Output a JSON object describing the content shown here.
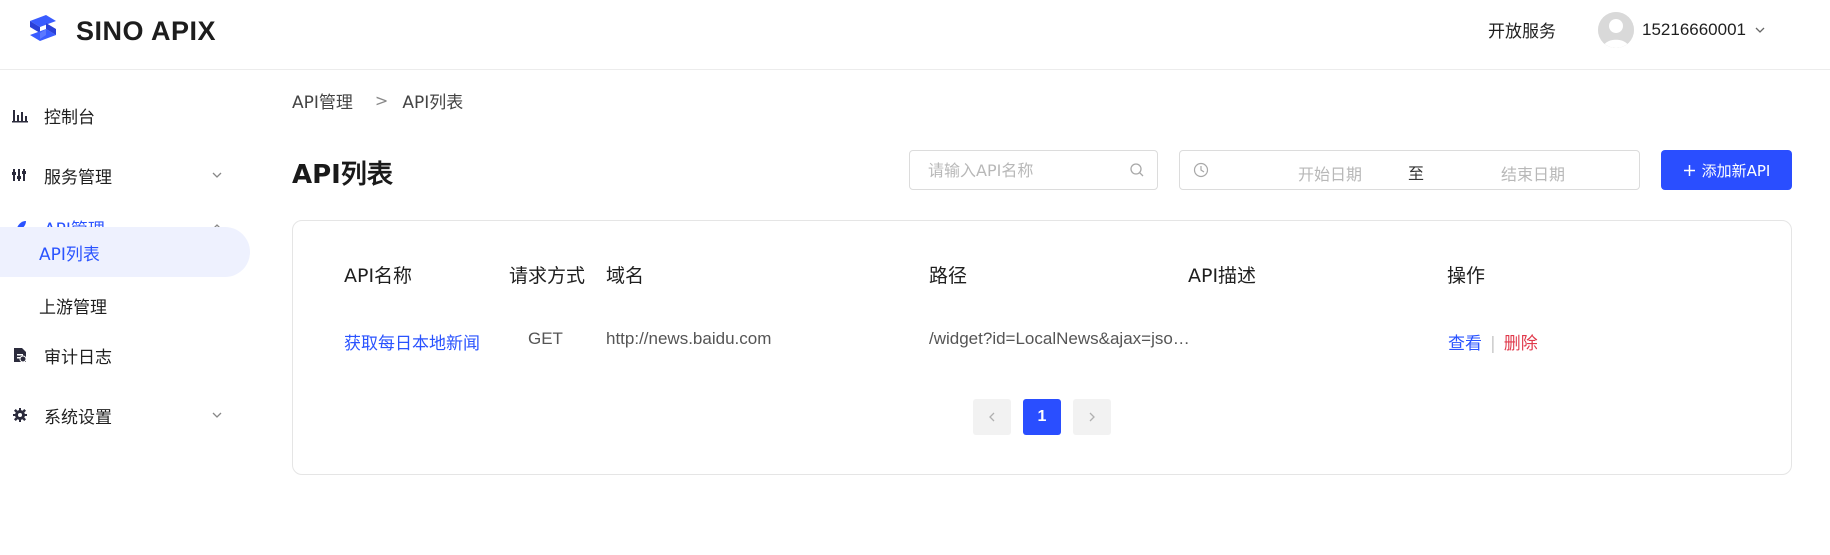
{
  "header": {
    "brand": "SINO APIX",
    "open_service": "开放服务",
    "user_phone": "15216660001"
  },
  "colors": {
    "accent": "#2a4eff",
    "link": "#2a53ff",
    "danger": "#e0394b",
    "sidebar_selected_bg": "#eef1fe"
  },
  "sidebar": {
    "items": [
      {
        "label": "控制台",
        "icon": "bar-chart-icon"
      },
      {
        "label": "服务管理",
        "icon": "sliders-icon",
        "expandable": true,
        "expanded": false
      },
      {
        "label": "API管理",
        "icon": "rocket-icon",
        "expandable": true,
        "expanded": true
      },
      {
        "label": "API列表",
        "sub": true,
        "selected": true
      },
      {
        "label": "上游管理",
        "sub": true
      },
      {
        "label": "审计日志",
        "icon": "log-file-icon"
      },
      {
        "label": "系统设置",
        "icon": "gear-icon",
        "expandable": true,
        "expanded": false
      }
    ]
  },
  "breadcrumb": {
    "parent": "API管理",
    "separator": ">",
    "current": "API列表"
  },
  "page": {
    "title": "API列表"
  },
  "search": {
    "placeholder": "请输入API名称",
    "value": ""
  },
  "date_range": {
    "start_placeholder": "开始日期",
    "separator": "至",
    "end_placeholder": "结束日期"
  },
  "toolbar": {
    "add_label": "添加新API"
  },
  "table": {
    "columns": [
      "API名称",
      "请求方式",
      "域名",
      "路径",
      "API描述",
      "操作"
    ],
    "rows": [
      {
        "name": "获取每日本地新闻",
        "method": "GET",
        "domain": "http://news.baidu.com",
        "path": "/widget?id=LocalNews&ajax=jso…",
        "description": "",
        "actions": {
          "view": "查看",
          "sep": "|",
          "delete": "删除"
        }
      }
    ]
  },
  "pagination": {
    "current_page": "1"
  }
}
